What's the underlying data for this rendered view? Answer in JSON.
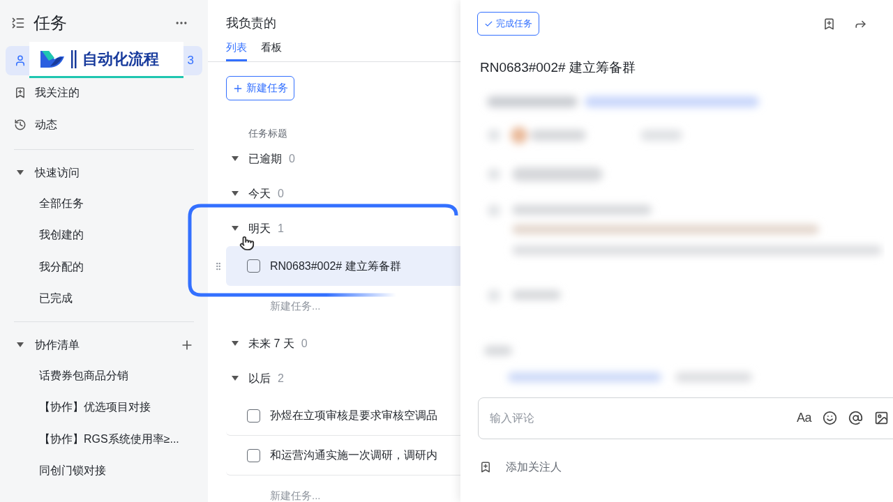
{
  "sidebar": {
    "title": "任务",
    "nav": [
      {
        "kind": "person",
        "count": "3",
        "selected": true
      },
      {
        "kind": "follow",
        "label": "我关注的",
        "selected": false
      },
      {
        "kind": "activity",
        "label": "动态",
        "selected": false
      }
    ],
    "sections": [
      {
        "title": "快速访问",
        "expanded": true,
        "has_add": false,
        "items": [
          "全部任务",
          "我创建的",
          "我分配的",
          "已完成"
        ]
      },
      {
        "title": "协作清单",
        "expanded": true,
        "has_add": true,
        "items": [
          "话费券包商品分销",
          "【协作】优选项目对接",
          "【协作】RGS系统使用率≥...",
          "同创门锁对接"
        ]
      }
    ]
  },
  "overlay_banner": {
    "text": "自动化流程"
  },
  "main": {
    "title": "我负责的",
    "tabs": [
      {
        "label": "列表",
        "selected": true
      },
      {
        "label": "看板",
        "selected": false
      }
    ],
    "new_task_button": "新建任务",
    "column_header": "任务标题",
    "groups": [
      {
        "title": "已逾期",
        "count": "0",
        "expanded": true
      },
      {
        "title": "今天",
        "count": "0",
        "expanded": true
      },
      {
        "title": "明天",
        "count": "1",
        "expanded": true,
        "tasks": [
          {
            "title": "RN0683#002# 建立筹备群",
            "checked": false,
            "selected": true
          }
        ],
        "add_task": "新建任务..."
      },
      {
        "title": "未来 7 天",
        "count": "0",
        "expanded": true
      },
      {
        "title": "以后",
        "count": "2",
        "expanded": true,
        "tasks": [
          {
            "title": "孙煜在立项审核是要求审核空调品",
            "checked": false,
            "selected": false
          },
          {
            "title": "和运营沟通实施一次调研，调研内",
            "checked": false,
            "selected": false
          }
        ],
        "add_task": "新建任务..."
      }
    ]
  },
  "detail": {
    "complete_button": "完成任务",
    "title": "RN0683#002# 建立筹备群",
    "comment_placeholder": "输入评论",
    "format_label": "Aa",
    "add_follower": "添加关注人"
  }
}
